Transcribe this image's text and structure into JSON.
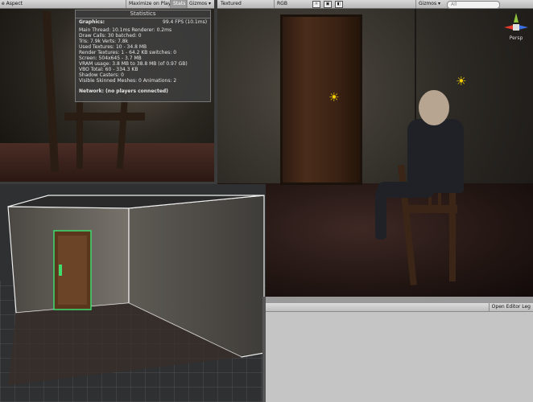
{
  "game_view": {
    "aspect_label": "e Aspect",
    "maximize_label": "Maximize on Play",
    "stats_label": "Stats",
    "gizmos_label": "Gizmos ▾"
  },
  "stats": {
    "title": "Statistics",
    "graphics_label": "Graphics:",
    "fps": "99.4 FPS (10.1ms)",
    "lines": [
      "Main Thread: 10.1ms  Renderer: 0.2ms",
      "Draw Calls: 30    batched: 0",
      "Tris: 7.9k    Verts: 7.8k",
      "Used Textures: 10 - 34.8 MB",
      "Render Textures: 1 - 64.2 KB    switches: 0",
      "Screen: 504x645 - 3.7 MB",
      "VRAM usage: 3.8 MB to 38.8 MB (of 0.97 GB)",
      "VBO Total: 60 - 334.3 KB",
      "Shadow Casters: 0",
      "Visible Skinned Meshes: 0    Animations: 2"
    ],
    "network": "Network: (no players connected)"
  },
  "scene_view": {
    "render_mode": "Textured",
    "color_mode": "RGB",
    "gizmos_label": "Gizmos ▾",
    "search_placeholder": "All",
    "persp_label": "Persp"
  },
  "bottom_panel": {
    "open_editor_label": "Open Editor Leg"
  },
  "colors": {
    "gizmo_x": "#e23b2e",
    "gizmo_y": "#8ec33b",
    "gizmo_z": "#3b6ee2",
    "light": "#f5d000",
    "door_highlight": "#3ddc6b"
  },
  "icons": [
    "sun-light-icon",
    "scene-gizmo-icon",
    "audio-icon",
    "image-icon",
    "toggle-icon"
  ]
}
